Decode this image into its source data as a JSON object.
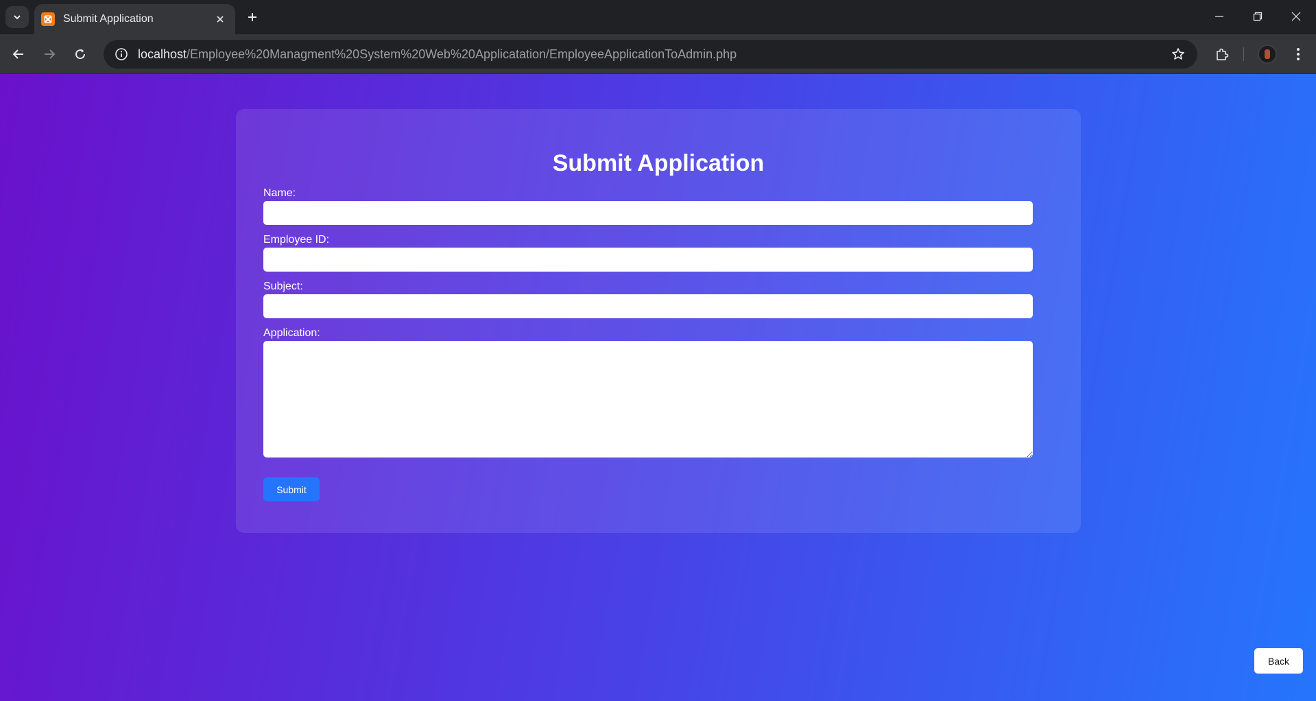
{
  "browser": {
    "tab": {
      "title": "Submit Application",
      "favicon": "xampp-icon",
      "favicon_color": "#f07c1c"
    },
    "address_bar": {
      "host": "localhost",
      "path": "/Employee%20Managment%20System%20Web%20Applicatation/EmployeeApplicationToAdmin.php"
    },
    "icons": {
      "tab_search": "chevron-down-icon",
      "tab_close": "close-icon",
      "new_tab": "plus-icon",
      "back": "arrow-left-icon",
      "forward": "arrow-right-icon",
      "reload": "reload-icon",
      "site_info": "info-icon",
      "bookmark": "star-icon",
      "extensions": "puzzle-icon",
      "profile": "avatar",
      "menu": "kebab-menu-icon",
      "minimize": "minimize-icon",
      "restore": "restore-icon",
      "close_window": "close-icon"
    }
  },
  "form": {
    "title": "Submit Application",
    "fields": [
      {
        "label": "Name:",
        "value": ""
      },
      {
        "label": "Employee ID:",
        "value": ""
      },
      {
        "label": "Subject:",
        "value": ""
      },
      {
        "label": "Application:",
        "value": ""
      }
    ],
    "submit_label": "Submit"
  },
  "back_label": "Back",
  "colors": {
    "gradient_start": "#6a11cb",
    "gradient_end": "#2575fc",
    "button_blue": "#2575fc"
  }
}
